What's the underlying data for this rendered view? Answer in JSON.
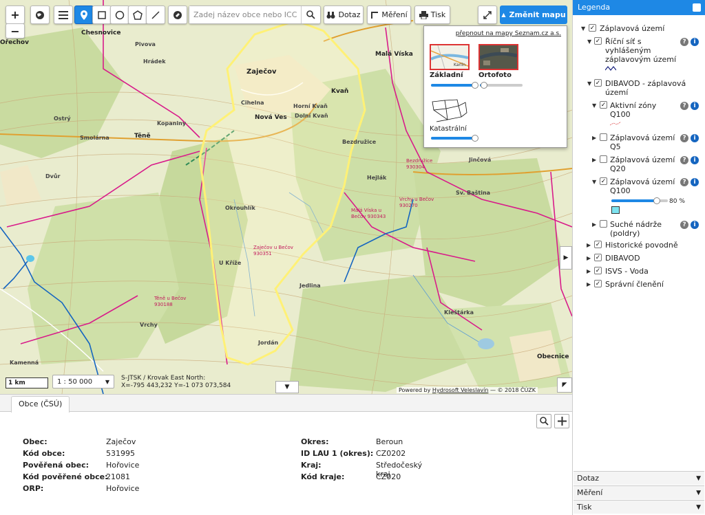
{
  "toolbar": {
    "search_placeholder": "Zadej název obce nebo ICC",
    "query_label": "Dotaz",
    "measure_label": "Měření",
    "print_label": "Tisk",
    "change_map_label": "Změnit mapu",
    "zoom_in": "+",
    "zoom_out": "−"
  },
  "basemap": {
    "seznam_link": "přepnout na mapy Seznam.cz a.s.",
    "options": [
      {
        "label": "Základní",
        "opacity": 1.0
      },
      {
        "label": "Ortofoto",
        "opacity": 0.1
      },
      {
        "label": "Katastrální",
        "opacity": 1.0
      }
    ]
  },
  "map": {
    "scale_bar": "1 km",
    "scale_value": "1 : 50 000",
    "crs_line": "S-JTSK / Krovak East North:",
    "coords_line": "X=-795 443,232 Y=-1 073 073,584",
    "attribution_prefix": "Powered by ",
    "attribution_link": "Hydrosoft Veleslavín",
    "attribution_suffix": " — © 2018 ČÚZK",
    "place_labels": [
      {
        "t": "Zaječov",
        "c": "#222",
        "s": 10
      },
      {
        "t": "Nová Ves",
        "c": "#222",
        "s": 9
      },
      {
        "t": "Kvaň",
        "c": "#222",
        "s": 9
      },
      {
        "t": "Těně",
        "c": "#222",
        "s": 9
      },
      {
        "t": "Chesnovice",
        "c": "#222",
        "s": 9
      },
      {
        "t": "Malá Víska",
        "c": "#222",
        "s": 9
      },
      {
        "t": "Ořechov",
        "c": "#222",
        "s": 9
      },
      {
        "t": "Obecnice",
        "c": "#222",
        "s": 9
      },
      {
        "t": "Jordán",
        "c": "#444",
        "s": 8
      },
      {
        "t": "Okrouhlík",
        "c": "#444",
        "s": 8
      },
      {
        "t": "Hejlák",
        "c": "#444",
        "s": 8
      },
      {
        "t": "Kleštárka",
        "c": "#444",
        "s": 8
      },
      {
        "t": "Kamenná",
        "c": "#444",
        "s": 8
      },
      {
        "t": "Vrchy",
        "c": "#444",
        "s": 8
      },
      {
        "t": "Dvůr",
        "c": "#444",
        "s": 8
      },
      {
        "t": "Cihelna",
        "c": "#444",
        "s": 8
      },
      {
        "t": "Dolní Kvaň",
        "c": "#444",
        "s": 8
      },
      {
        "t": "Horní Kvaň",
        "c": "#444",
        "s": 8
      },
      {
        "t": "Bezdružice",
        "c": "#444",
        "s": 8
      },
      {
        "t": "Jedlina",
        "c": "#444",
        "s": 8
      },
      {
        "t": "U Kříže",
        "c": "#444",
        "s": 8
      },
      {
        "t": "Jinčová",
        "c": "#444",
        "s": 8
      },
      {
        "t": "Zaječov u Bečov 930351",
        "c": "#c2185b",
        "s": 7
      },
      {
        "t": "Malá Víska u Bečov 930343",
        "c": "#c2185b",
        "s": 7
      },
      {
        "t": "Těně u Bečov 930188",
        "c": "#c2185b",
        "s": 7
      },
      {
        "t": "Vrchy u Bečov 930270",
        "c": "#c2185b",
        "s": 7
      },
      {
        "t": "Bezdružice 930304",
        "c": "#c2185b",
        "s": 7
      },
      {
        "t": "Sv. Baština",
        "c": "#444",
        "s": 8
      },
      {
        "t": "Hrádek",
        "c": "#444",
        "s": 8
      },
      {
        "t": "Ostrý",
        "c": "#444",
        "s": 8
      },
      {
        "t": "Kopaniny",
        "c": "#444",
        "s": 8
      },
      {
        "t": "Smolárna",
        "c": "#444",
        "s": 8
      },
      {
        "t": "Pivova",
        "c": "#444",
        "s": 8
      }
    ]
  },
  "info": {
    "tab_label": "Obce (ČSÚ)",
    "left": [
      {
        "key": "Obec:",
        "value": "Zaječov"
      },
      {
        "key": "Kód obce:",
        "value": "531995"
      },
      {
        "key": "Pověřená obec:",
        "value": "Hořovice"
      },
      {
        "key": "Kód pověřené obce:",
        "value": "21081"
      },
      {
        "key": "ORP:",
        "value": "Hořovice"
      }
    ],
    "right": [
      {
        "key": "Okres:",
        "value": "Beroun"
      },
      {
        "key": "ID LAU 1 (okres):",
        "value": "CZ0202"
      },
      {
        "key": "Kraj:",
        "value": "Středočeský kraj"
      },
      {
        "key": "Kód kraje:",
        "value": "CZ020"
      }
    ]
  },
  "legend": {
    "title": "Legenda",
    "root": "Záplavová území",
    "river_network": "Říční síť s vyhlášeným záplavovým území",
    "dibavod_zones": "DIBAVOD - záplavová území",
    "active": "Aktivní zóny Q100",
    "q5": "Záplavová území Q5",
    "q20": "Záplavová území Q20",
    "q100": "Záplavová území Q100",
    "q100_opacity": "80 %",
    "q100_opacity_value": 0.8,
    "dry_tanks": "Suché nádrže (poldry)",
    "historic": "Historické povodně",
    "dibavod": "DIBAVOD",
    "isvs": "ISVS - Voda",
    "admin": "Správní členění",
    "help_symbol": "?",
    "info_symbol": "i",
    "q100_color": "#7de3f0",
    "accordion": [
      "Dotaz",
      "Měření",
      "Tisk"
    ]
  },
  "colors": {
    "accent": "#1e88e5",
    "boundary": "#d81b8a",
    "selection": "#fff176",
    "river": "#1565c0"
  }
}
